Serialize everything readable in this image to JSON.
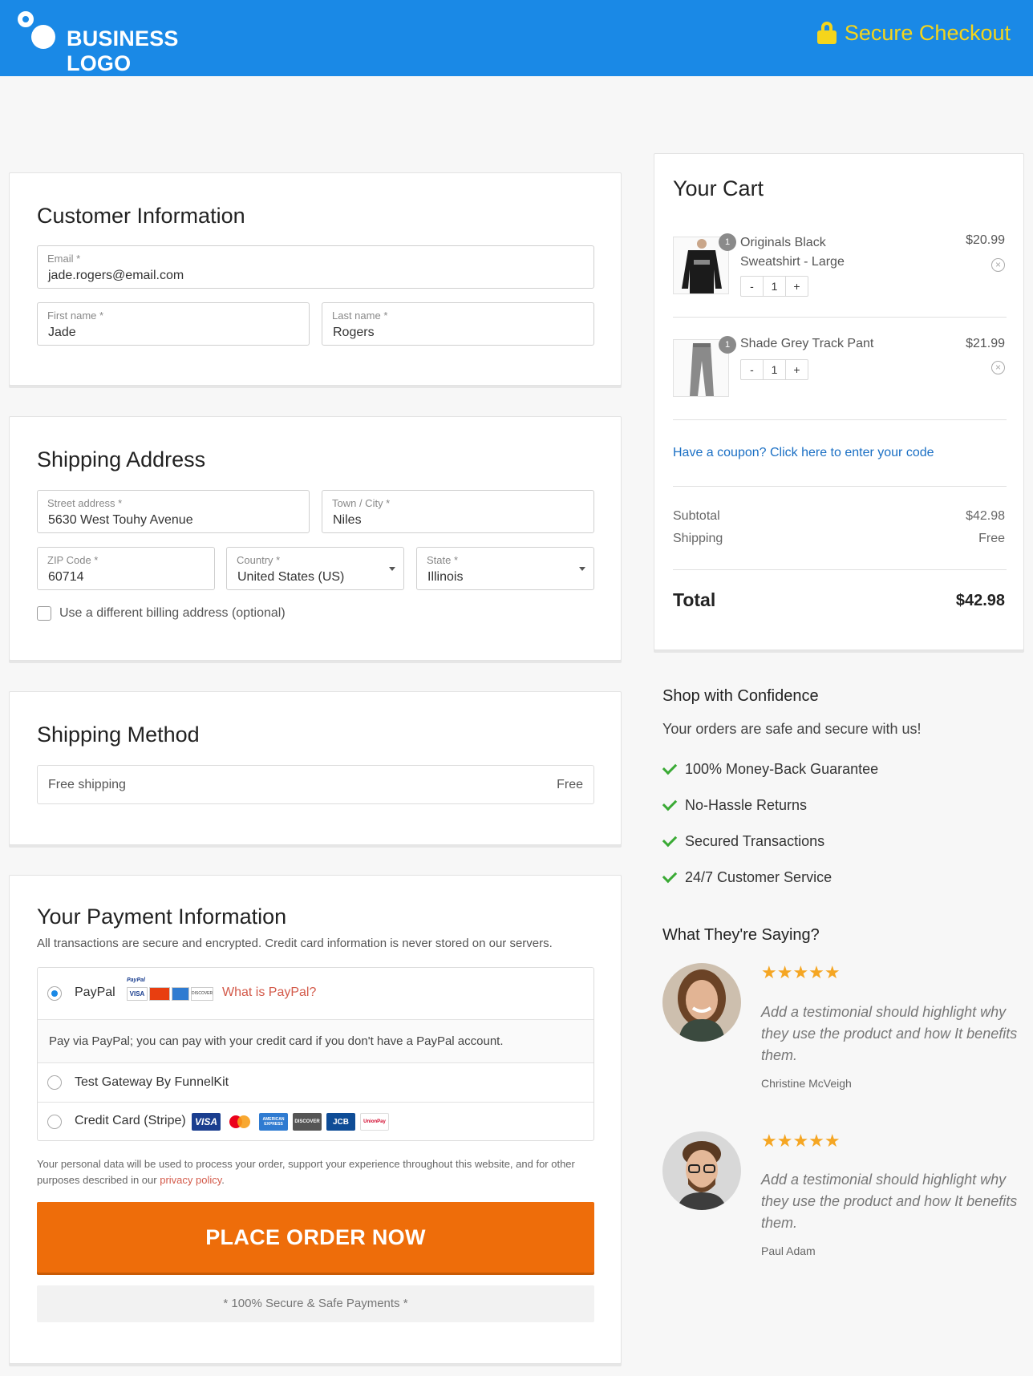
{
  "header": {
    "logo_text": "BUSINESS LOGO",
    "secure_checkout": "Secure Checkout",
    "bg_color": "#1a89e6",
    "accent_color": "#f5d51b"
  },
  "customer": {
    "title": "Customer Information",
    "email_label": "Email *",
    "email_value": "jade.rogers@email.com",
    "first_label": "First name *",
    "first_value": "Jade",
    "last_label": "Last name *",
    "last_value": "Rogers"
  },
  "shipping": {
    "title": "Shipping Address",
    "street_label": "Street address *",
    "street_value": "5630 West Touhy Avenue",
    "city_label": "Town / City *",
    "city_value": "Niles",
    "zip_label": "ZIP Code *",
    "zip_value": "60714",
    "country_label": "Country *",
    "country_value": "United States (US)",
    "state_label": "State *",
    "state_value": "Illinois",
    "billing_checkbox": "Use a different billing address (optional)"
  },
  "shipping_method": {
    "title": "Shipping Method",
    "option": "Free shipping",
    "price": "Free"
  },
  "payment": {
    "title": "Your Payment Information",
    "subtitle": "All transactions are secure and encrypted. Credit card information is never stored on our servers.",
    "paypal_label": "PayPal",
    "paypal_brand": "PayPal",
    "paypal_link": "What is PayPal?",
    "paypal_desc": "Pay via PayPal; you can pay with your credit card if you don't have a PayPal account.",
    "test_gateway": "Test Gateway By FunnelKit",
    "stripe_label": "Credit Card (Stripe)",
    "card_visa": "VISA",
    "card_amex": "AMERICAN EXPRESS",
    "card_discover": "DISCOVER",
    "card_jcb": "JCB",
    "card_unionpay": "UnionPay",
    "privacy_text": "Your personal data will be used to process your order, support your experience throughout this website, and for other purposes described in our",
    "privacy_link": "privacy policy",
    "privacy_end": ".",
    "place_order": "PLACE ORDER NOW",
    "secure_payments": "* 100% Secure & Safe Payments *",
    "button_color": "#ee6d0a"
  },
  "cart": {
    "title": "Your Cart",
    "items": [
      {
        "name_line1": "Originals Black",
        "name_line2": "Sweatshirt - Large",
        "price": "$20.99",
        "qty": "1",
        "badge": "1"
      },
      {
        "name_line1": "Shade Grey Track Pant",
        "price": "$21.99",
        "qty": "1",
        "badge": "1"
      }
    ],
    "minus": "-",
    "plus": "+",
    "coupon": "Have a coupon? Click here to enter your code",
    "subtotal_label": "Subtotal",
    "subtotal_value": "$42.98",
    "shipping_label": "Shipping",
    "shipping_value": "Free",
    "total_label": "Total",
    "total_value": "$42.98"
  },
  "confidence": {
    "title": "Shop with Confidence",
    "subtitle": "Your orders are safe and secure with us!",
    "items": [
      "100% Money-Back Guarantee",
      "No-Hassle Returns",
      "Secured Transactions",
      "24/7 Customer Service"
    ]
  },
  "testimonials": {
    "title": "What They're Saying?",
    "items": [
      {
        "stars": "★★★★★",
        "text": "Add a testimonial should highlight why they use the product and how It benefits them.",
        "author": "Christine McVeigh"
      },
      {
        "stars": "★★★★★",
        "text": "Add a testimonial should highlight why they use the product and how It benefits them.",
        "author": "Paul Adam"
      }
    ]
  }
}
